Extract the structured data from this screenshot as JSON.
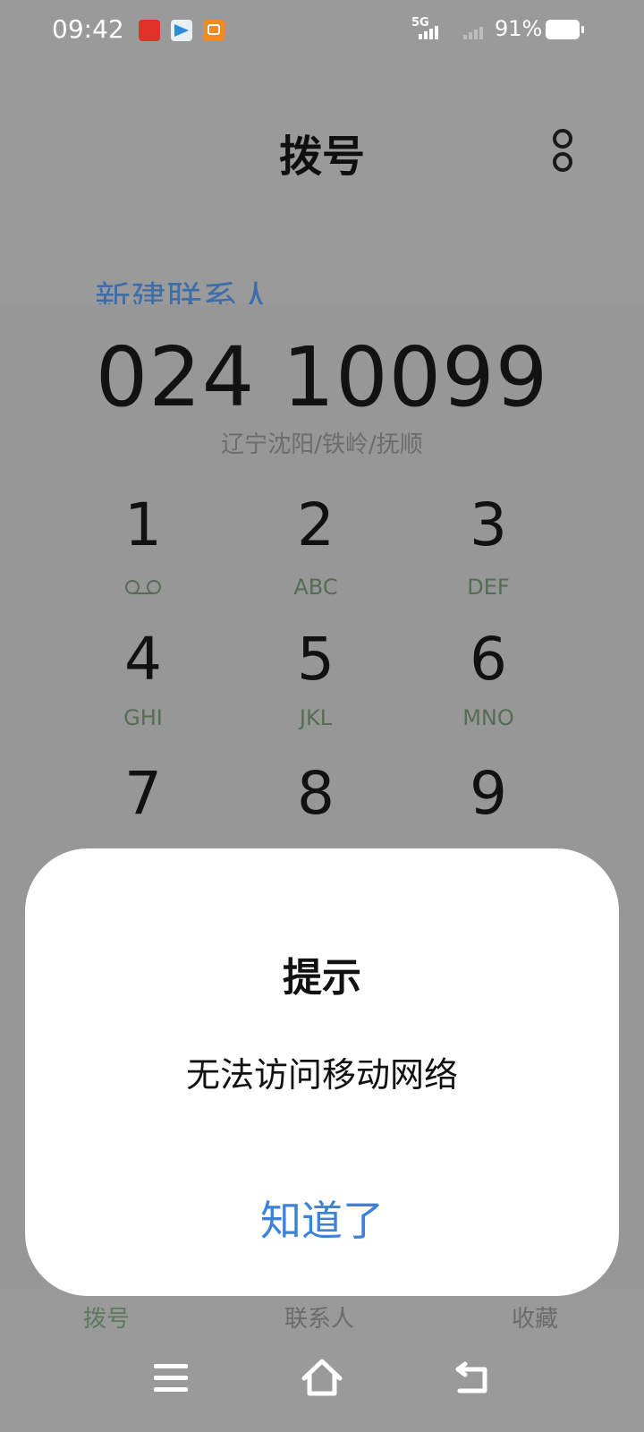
{
  "status_bar": {
    "time": "09:42",
    "network_label": "5G",
    "battery_percent": "91%",
    "notification_icons": [
      "video-app-icon",
      "telegram-icon",
      "shopping-app-icon"
    ]
  },
  "header": {
    "title": "拨号",
    "more_icon": "more-options-icon"
  },
  "new_contact_label": "新建联系人",
  "dialed_number": "024 10099",
  "number_location": "辽宁沈阳/铁岭/抚顺",
  "keypad": [
    {
      "digit": "1",
      "letters": ""
    },
    {
      "digit": "2",
      "letters": "ABC"
    },
    {
      "digit": "3",
      "letters": "DEF"
    },
    {
      "digit": "4",
      "letters": "GHI"
    },
    {
      "digit": "5",
      "letters": "JKL"
    },
    {
      "digit": "6",
      "letters": "MNO"
    },
    {
      "digit": "7",
      "letters": ""
    },
    {
      "digit": "8",
      "letters": ""
    },
    {
      "digit": "9",
      "letters": ""
    }
  ],
  "bottom_tabs": [
    {
      "label": "拨号",
      "active": true
    },
    {
      "label": "联系人",
      "active": false
    },
    {
      "label": "收藏",
      "active": false
    }
  ],
  "dialog": {
    "title": "提示",
    "message": "无法访问移动网络",
    "button_label": "知道了"
  },
  "colors": {
    "dim_background": "#9a9a9a",
    "accent_blue": "#3b82d8",
    "tab_active_green": "#5a7a5a",
    "new_contact_blue": "#3d6daa"
  }
}
